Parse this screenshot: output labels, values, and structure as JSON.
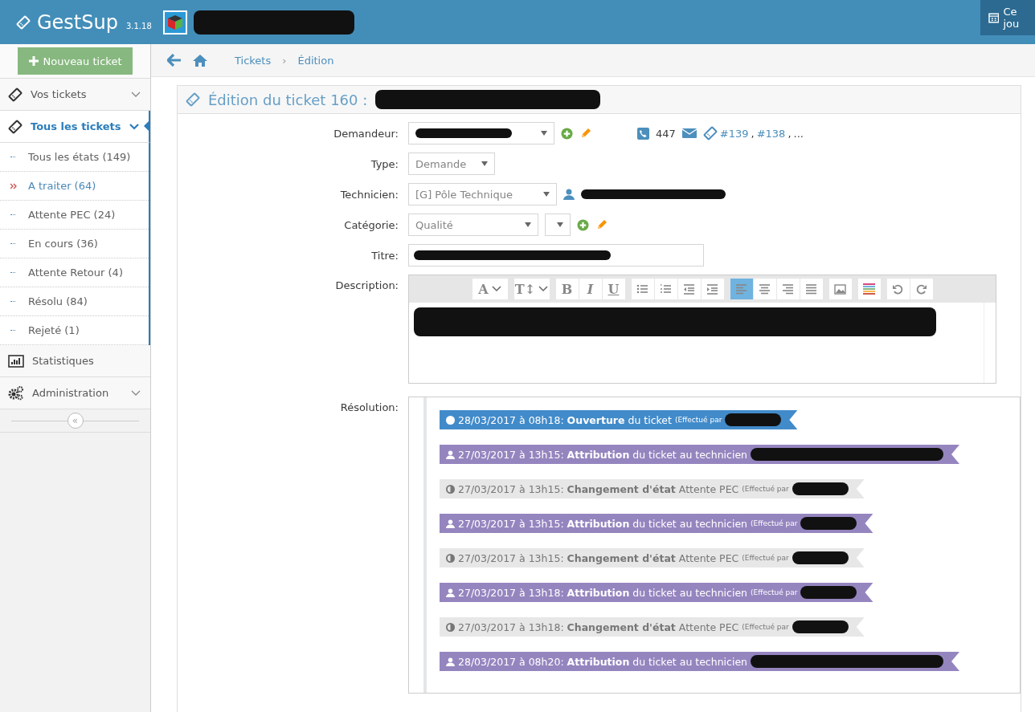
{
  "header": {
    "app_name": "GestSup",
    "version": "3.1.18",
    "calendar_label": "Ce jou"
  },
  "new_ticket_button": "Nouveau ticket",
  "sidebar": {
    "items": [
      {
        "label": "Vos tickets",
        "expanded": false,
        "selected": false
      },
      {
        "label": "Tous les tickets",
        "expanded": true,
        "selected": true,
        "children": [
          {
            "label": "Tous les états (149)",
            "selected": false
          },
          {
            "label": "A traiter (64)",
            "selected": true
          },
          {
            "label": "Attente PEC (24)",
            "selected": false
          },
          {
            "label": "En cours (36)",
            "selected": false
          },
          {
            "label": "Attente Retour (4)",
            "selected": false
          },
          {
            "label": "Résolu (84)",
            "selected": false
          },
          {
            "label": "Rejeté (1)",
            "selected": false
          }
        ]
      },
      {
        "label": "Statistiques",
        "selected": false
      },
      {
        "label": "Administration",
        "expanded": false,
        "selected": false
      }
    ],
    "collapse_symbol": "«"
  },
  "breadcrumb": [
    "Tickets",
    "Édition"
  ],
  "breadcrumb_separator": "›",
  "panel_title": "Édition du ticket 160 :",
  "form": {
    "demandeur": {
      "label": "Demandeur:",
      "phone": "447",
      "tickets": [
        "#139",
        "#138"
      ],
      "ticket_separator": ",",
      "more": "..."
    },
    "type": {
      "label": "Type:",
      "value": "Demande"
    },
    "technicien": {
      "label": "Technicien:",
      "value": "[G] Pôle Technique"
    },
    "categorie": {
      "label": "Catégorie:",
      "value": "Qualité"
    },
    "titre": {
      "label": "Titre:"
    },
    "description": {
      "label": "Description:",
      "toolbar": [
        {
          "kind": "font",
          "label": "A",
          "selected": false
        },
        {
          "kind": "size",
          "label": "T↕",
          "selected": false
        },
        {
          "kind": "bold",
          "label": "B",
          "selected": false
        },
        {
          "kind": "italic",
          "label": "I",
          "selected": false
        },
        {
          "kind": "underline",
          "label": "U",
          "selected": false
        },
        {
          "kind": "bullets",
          "selected": false
        },
        {
          "kind": "numbers",
          "selected": false
        },
        {
          "kind": "outdent",
          "selected": false
        },
        {
          "kind": "indent",
          "selected": false
        },
        {
          "kind": "align-left",
          "selected": true
        },
        {
          "kind": "align-center",
          "selected": false
        },
        {
          "kind": "align-right",
          "selected": false
        },
        {
          "kind": "justify",
          "selected": false
        },
        {
          "kind": "image",
          "selected": false
        },
        {
          "kind": "colors",
          "selected": false
        },
        {
          "kind": "undo",
          "selected": false
        },
        {
          "kind": "redo",
          "selected": false
        }
      ]
    },
    "resolution": {
      "label": "Résolution:",
      "events": [
        {
          "kind": "open",
          "date": "28/03/2017 à 08h18:",
          "action": "Ouverture",
          "detail": "du ticket",
          "by": "(Effectué par"
        },
        {
          "kind": "assign",
          "date": "27/03/2017 à 13h15:",
          "action": "Attribution",
          "detail": "du ticket au technicien"
        },
        {
          "kind": "state",
          "date": "27/03/2017 à 13h15:",
          "action": "Changement d'état",
          "detail": "Attente PEC",
          "by": "(Effectué par"
        },
        {
          "kind": "assign",
          "date": "27/03/2017 à 13h15:",
          "action": "Attribution",
          "detail": "du ticket au technicien",
          "by": "(Effectué par"
        },
        {
          "kind": "state",
          "date": "27/03/2017 à 13h15:",
          "action": "Changement d'état",
          "detail": "Attente PEC",
          "by": "(Effectué par"
        },
        {
          "kind": "assign",
          "date": "27/03/2017 à 13h18:",
          "action": "Attribution",
          "detail": "du ticket au technicien",
          "by": "(Effectué par"
        },
        {
          "kind": "state",
          "date": "27/03/2017 à 13h18:",
          "action": "Changement d'état",
          "detail": "Attente PEC",
          "by": "(Effectué par"
        },
        {
          "kind": "assign",
          "date": "28/03/2017 à 08h20:",
          "action": "Attribution",
          "detail": "du ticket au technicien"
        }
      ]
    }
  }
}
